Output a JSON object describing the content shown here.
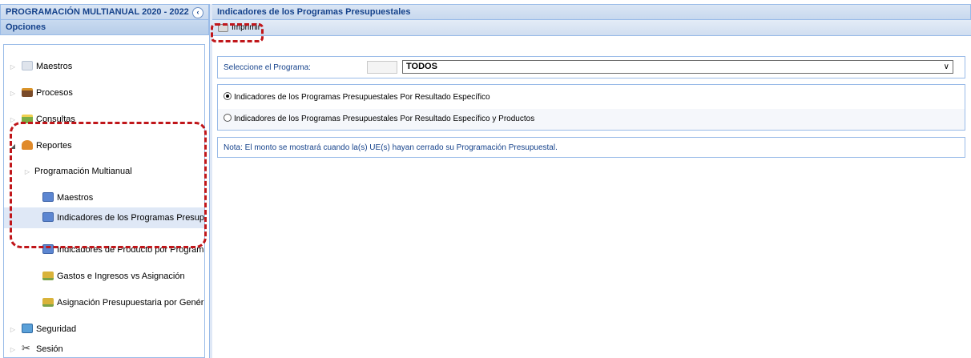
{
  "sidebar": {
    "app_title": "PROGRAMACIÓN MULTIANUAL 2020 - 2022",
    "collapse_icon": "‹",
    "options_header": "Opciones",
    "items": [
      {
        "label": "Maestros",
        "icon": "folder-icon"
      },
      {
        "label": "Procesos",
        "icon": "book-icon"
      },
      {
        "label": "Consultas",
        "icon": "folder-search-icon"
      },
      {
        "label": "Reportes",
        "icon": "chart-icon"
      },
      {
        "label": "Programación Multianual",
        "icon": ""
      },
      {
        "label": "Maestros",
        "icon": "report-icon"
      },
      {
        "label": "Indicadores de los Programas Presupuestales",
        "icon": "report-icon"
      },
      {
        "label": "Indicadores de Producto por Programa",
        "icon": "report-icon"
      },
      {
        "label": "Gastos e Ingresos vs Asignación",
        "icon": "money-icon"
      },
      {
        "label": "Asignación Presupuestaria por Genérica",
        "icon": "money-icon"
      },
      {
        "label": "Seguridad",
        "icon": "users-icon"
      },
      {
        "label": "Sesión",
        "icon": "tools-icon"
      }
    ]
  },
  "main": {
    "title": "Indicadores de los Programas Presupuestales",
    "print_label": "Imprimir",
    "program_label": "Seleccione el Programa:",
    "program_value": "TODOS",
    "options": [
      "Indicadores de los Programas Presupuestales Por Resultado Específico",
      "Indicadores de los Programas Presupuestales Por Resultado Específico y Productos"
    ],
    "selected_option": 0,
    "note": "Nota: El monto se mostrará cuando la(s) UE(s) hayan cerrado su Programación Presupuestal."
  },
  "colors": {
    "header_text": "#15428b",
    "border": "#99bbe8",
    "highlight_dash": "#c0161a",
    "selected_row": "#dfe8f6"
  }
}
